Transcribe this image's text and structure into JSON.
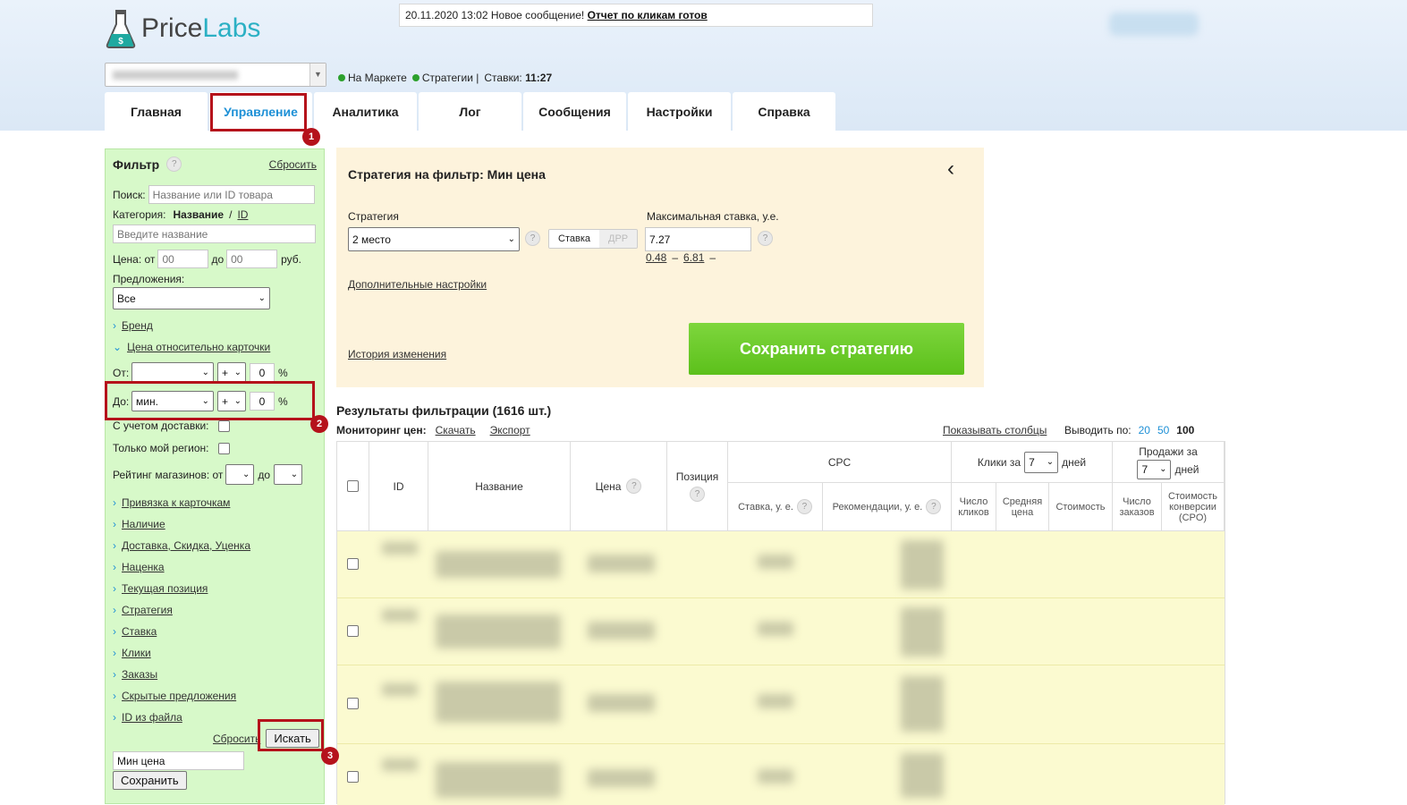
{
  "header": {
    "logo": {
      "part1": "Price",
      "part2": "Labs"
    },
    "notice": {
      "time": "20.11.2020 13:02",
      "text": "Новое сообщение!",
      "link": "Отчет по кликам готов"
    },
    "status": {
      "market": "На Маркете",
      "strategies": "Стратегии |",
      "bids_label": "Ставки:",
      "bids_time": "11:27"
    }
  },
  "tabs": [
    "Главная",
    "Управление",
    "Аналитика",
    "Лог",
    "Сообщения",
    "Настройки",
    "Справка"
  ],
  "filter": {
    "title": "Фильтр",
    "help": "?",
    "reset_top": "Сбросить",
    "search_label": "Поиск:",
    "search_placeholder": "Название или ID товара",
    "category_label": "Категория:",
    "category_name": "Название",
    "category_sep": "/",
    "category_id": "ID",
    "category_placeholder": "Введите название",
    "price_from": "Цена: от",
    "price_from_val": "00",
    "price_to": "до",
    "price_to_val": "00",
    "price_unit": "руб.",
    "offers_label": "Предложения:",
    "offers_value": "Все",
    "brand": "Бренд",
    "rel_price": "Цена относительно карточки",
    "from_label": "От:",
    "from_sign": "+",
    "from_val": "0",
    "pct": "%",
    "to_label": "До:",
    "to_select": "мин.",
    "to_sign": "+",
    "to_val": "0",
    "delivery": "С учетом доставки:",
    "region": "Только мой регион:",
    "rating": "Рейтинг магазинов: от",
    "rating_to": "до",
    "items": [
      "Привязка к карточкам",
      "Наличие",
      "Доставка, Скидка, Уценка",
      "Наценка",
      "Текущая позиция",
      "Стратегия",
      "Ставка",
      "Клики",
      "Заказы",
      "Скрытые предложения",
      "ID из файла"
    ],
    "reset_bottom": "Сбросить",
    "search_button": "Искать",
    "save_name": "Мин цена",
    "save_button": "Сохранить"
  },
  "strategy": {
    "title": "Стратегия на фильтр: Мин цена",
    "strategy_label": "Стратегия",
    "strategy_value": "2 место",
    "toggle_bid": "Ставка",
    "toggle_drr": "ДРР",
    "max_bid_label": "Максимальная ставка, у.е.",
    "max_bid_value": "7.27",
    "range_min": "0.48",
    "range_dash": "–",
    "range_max": "6.81",
    "range_end": "–",
    "advanced": "Дополнительные настройки",
    "history": "История изменения",
    "save": "Сохранить стратегию"
  },
  "results": {
    "title": "Результаты фильтрации (1616 шт.)",
    "monitoring": "Мониторинг цен:",
    "download": "Скачать",
    "export": "Экспорт",
    "show_cols": "Показывать столбцы",
    "per_page": "Выводить по:",
    "pages": [
      "20",
      "50",
      "100"
    ]
  },
  "table": {
    "id": "ID",
    "name": "Название",
    "price": "Цена",
    "position": "Позиция",
    "cpc": "CPC",
    "clicks_for": "Клики за",
    "clicks_days": "7",
    "days": "дней",
    "sales_for": "Продажи за",
    "sales_days": "7",
    "bid": "Ставка, у. е.",
    "rec": "Рекомендации, у. е.",
    "num_clicks": "Число кликов",
    "avg_price": "Средняя цена",
    "cost": "Стоимость",
    "num_orders": "Число заказов",
    "cpo": "Стоимость конверсии (CPO)"
  },
  "annotations": [
    "1",
    "2",
    "3"
  ],
  "colors": {
    "accent": "#1e90d6",
    "highlight": "#b5121b",
    "filter_bg": "#d7f9c9",
    "save_green": "#6ccc2a"
  }
}
